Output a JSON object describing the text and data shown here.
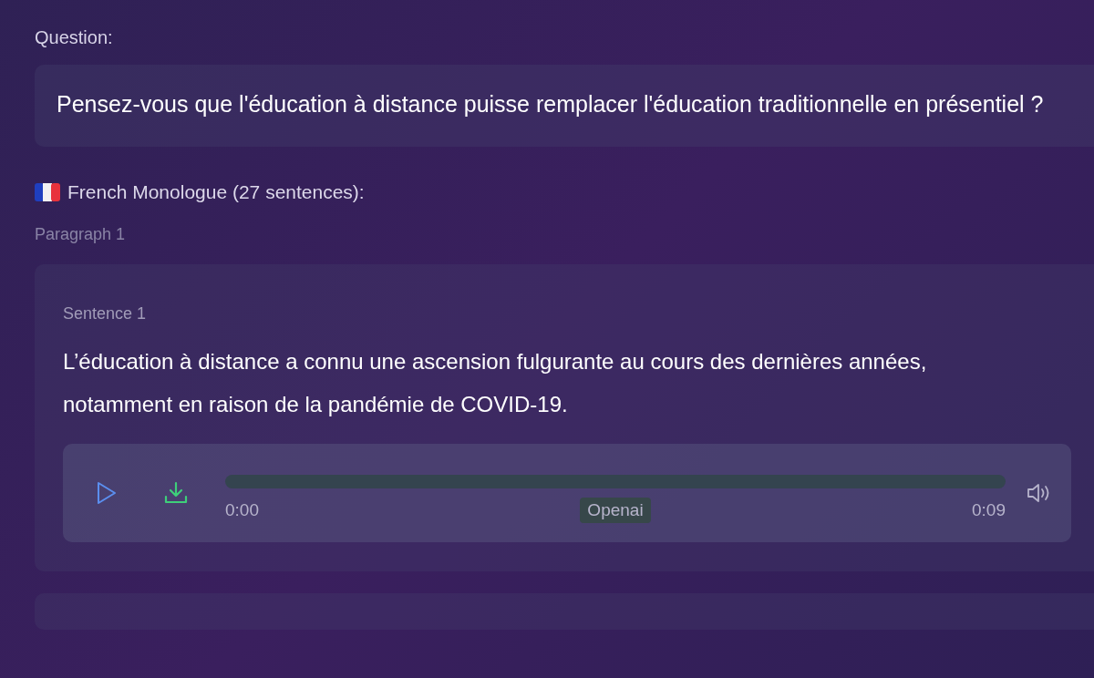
{
  "question_label": "Question:",
  "question": "Pensez-vous que l'éducation à distance puisse remplacer l'éducation traditionnelle en présentiel ?",
  "monologue_heading": "French Monologue (27 sentences):",
  "paragraphs": [
    {
      "label": "Paragraph 1",
      "sentences": [
        {
          "label": "Sentence 1",
          "text": "L’éducation à distance a connu une ascension fulgurante au cours des dernières années, notamment en raison de la pandémie de COVID-19.",
          "player": {
            "level": 0,
            "current_time": "0:00",
            "voice": "Openai",
            "duration": "0:09"
          }
        }
      ]
    }
  ]
}
